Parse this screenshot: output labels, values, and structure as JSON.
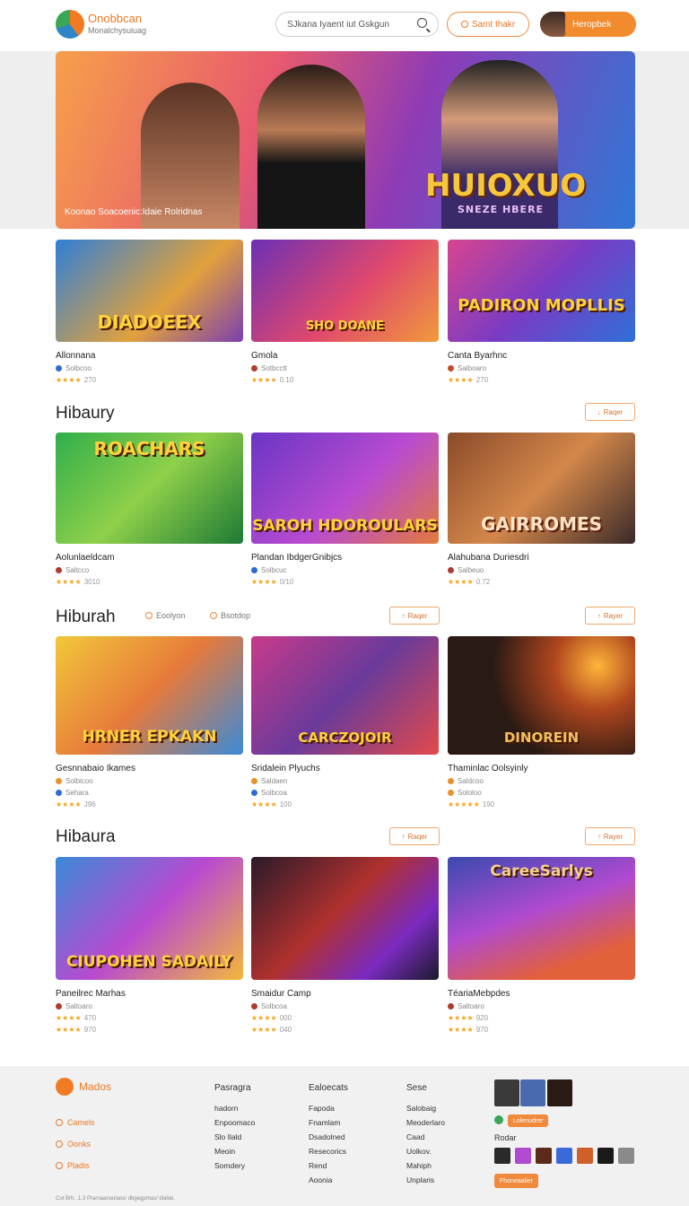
{
  "header": {
    "logo_name": "Onobbcan",
    "logo_sub": "Monalchysuiuag",
    "search_placeholder": "SJkana Iyaent iut Gskgun",
    "btn_submit": "Samt Ihakr",
    "user_label": "Heropbek"
  },
  "hero": {
    "caption": "Koonao Soacoenic:Idaie Rolridnas",
    "logo_text": "HUIOXUO",
    "logo_sub": "SNEZE HBERE"
  },
  "row1": [
    {
      "title": "Allonnana",
      "meta": "Solbcoo",
      "rating": "★★★★",
      "score": "270",
      "art": "DIADOEEX",
      "dot": "#2a6bd4"
    },
    {
      "title": "Gmola",
      "meta": "Sotbcctt",
      "rating": "★★★★",
      "score": "0.10",
      "art": "SHO DOANE",
      "dot": "#b03a2e"
    },
    {
      "title": "Canta Byarhnc",
      "meta": "Salboaro",
      "rating": "★★★★",
      "score": "270",
      "art": "PADIRON MOPLLIS",
      "dot": "#c84a2a"
    }
  ],
  "sec1": {
    "title": "Hibaury",
    "btn": "Raqer"
  },
  "row2": [
    {
      "title": "Aolunlaeldcam",
      "meta": "Saltcco",
      "rating": "★★★★",
      "score": "3010",
      "art": "ROACHARS",
      "dot": "#b03a2e"
    },
    {
      "title": "Plandan IbdgerGnibjcs",
      "meta": "Solbcuc",
      "rating": "★★★★",
      "score": "0/10",
      "art": "SAROH HDOROULARS",
      "dot": "#2a6bd4"
    },
    {
      "title": "Alahubana Duriesdri",
      "meta": "Salbeuo",
      "rating": "★★★★",
      "score": "0.72",
      "art": "GAIRROMES",
      "dot": "#b03a2e"
    }
  ],
  "sec2": {
    "title": "Hiburah",
    "filter1": "Eoolyon",
    "filter2": "Bsotdop",
    "btn": "Raqer",
    "btn2": "Rayer"
  },
  "row3": [
    {
      "title": "Gesnnabaio Ikames",
      "meta": "Solbicoo",
      "meta2": "Sehara",
      "rating": "★★★★",
      "score": "J96",
      "art": "HRNER EPKAKN",
      "dot": "#e8922a"
    },
    {
      "title": "Sridalein Plyuchs",
      "meta": "Saldaen",
      "meta2": "Solbcoa",
      "rating": "★★★★",
      "score": "100",
      "art": "CARCZOJOIR",
      "dot": "#e8922a"
    },
    {
      "title": "Thaminlac Oolsyinly",
      "meta": "Saldcoo",
      "meta2": "Sololoo",
      "rating": "★★★★★",
      "score": "190",
      "art": "DINOREIN",
      "dot": "#e8922a"
    }
  ],
  "sec3": {
    "title": "Hibaura",
    "btn": "Raqer",
    "btn2": "Rayer"
  },
  "row4": [
    {
      "title": "Paneilrec Marhas",
      "meta": "Saltoaro",
      "rating": "★★★★",
      "score": "470",
      "rating2": "★★★★",
      "score2": "970",
      "art": "CIUPOHEN SADAILY",
      "dot": "#b03a2e"
    },
    {
      "title": "Smaidur Camp",
      "meta": "Solbcoa",
      "rating": "★★★★",
      "score": "000",
      "rating2": "★★★★",
      "score2": "040",
      "art": "",
      "dot": "#b03a2e"
    },
    {
      "title": "TéariaMebpdes",
      "meta": "Saltoaro",
      "rating": "★★★★",
      "score": "920",
      "rating2": "★★★★",
      "score2": "970",
      "art": "CareeSarlys",
      "dot": "#b03a2e"
    }
  ],
  "footer": {
    "logo": "Mados",
    "links": [
      "Camels",
      "Oonks",
      "Pladis"
    ],
    "col1": {
      "head": "Pasragra",
      "items": [
        "hadorn",
        "Enpoomaco",
        "Slo Ilald",
        "Meoin",
        "Somdery"
      ]
    },
    "col2": {
      "head": "Ealoecats",
      "items": [
        "Fapoda",
        "Fnamlam",
        "Dsadolned",
        "Resecorics",
        "Rend",
        "Aoonia"
      ]
    },
    "col3": {
      "head": "Sese",
      "items": [
        "Salobaig",
        "Meoderlaro",
        "Caad",
        "Uolkov.",
        "Mahiph",
        "Unplaris"
      ]
    },
    "badge1": "Lolenudrer",
    "follow": "Rodar",
    "badge2": "Fhoneaalier",
    "copyright": "Cut Brlt. ,1.3 Prarnaanoulaos/ dbgegpmas/ dialiat,"
  }
}
